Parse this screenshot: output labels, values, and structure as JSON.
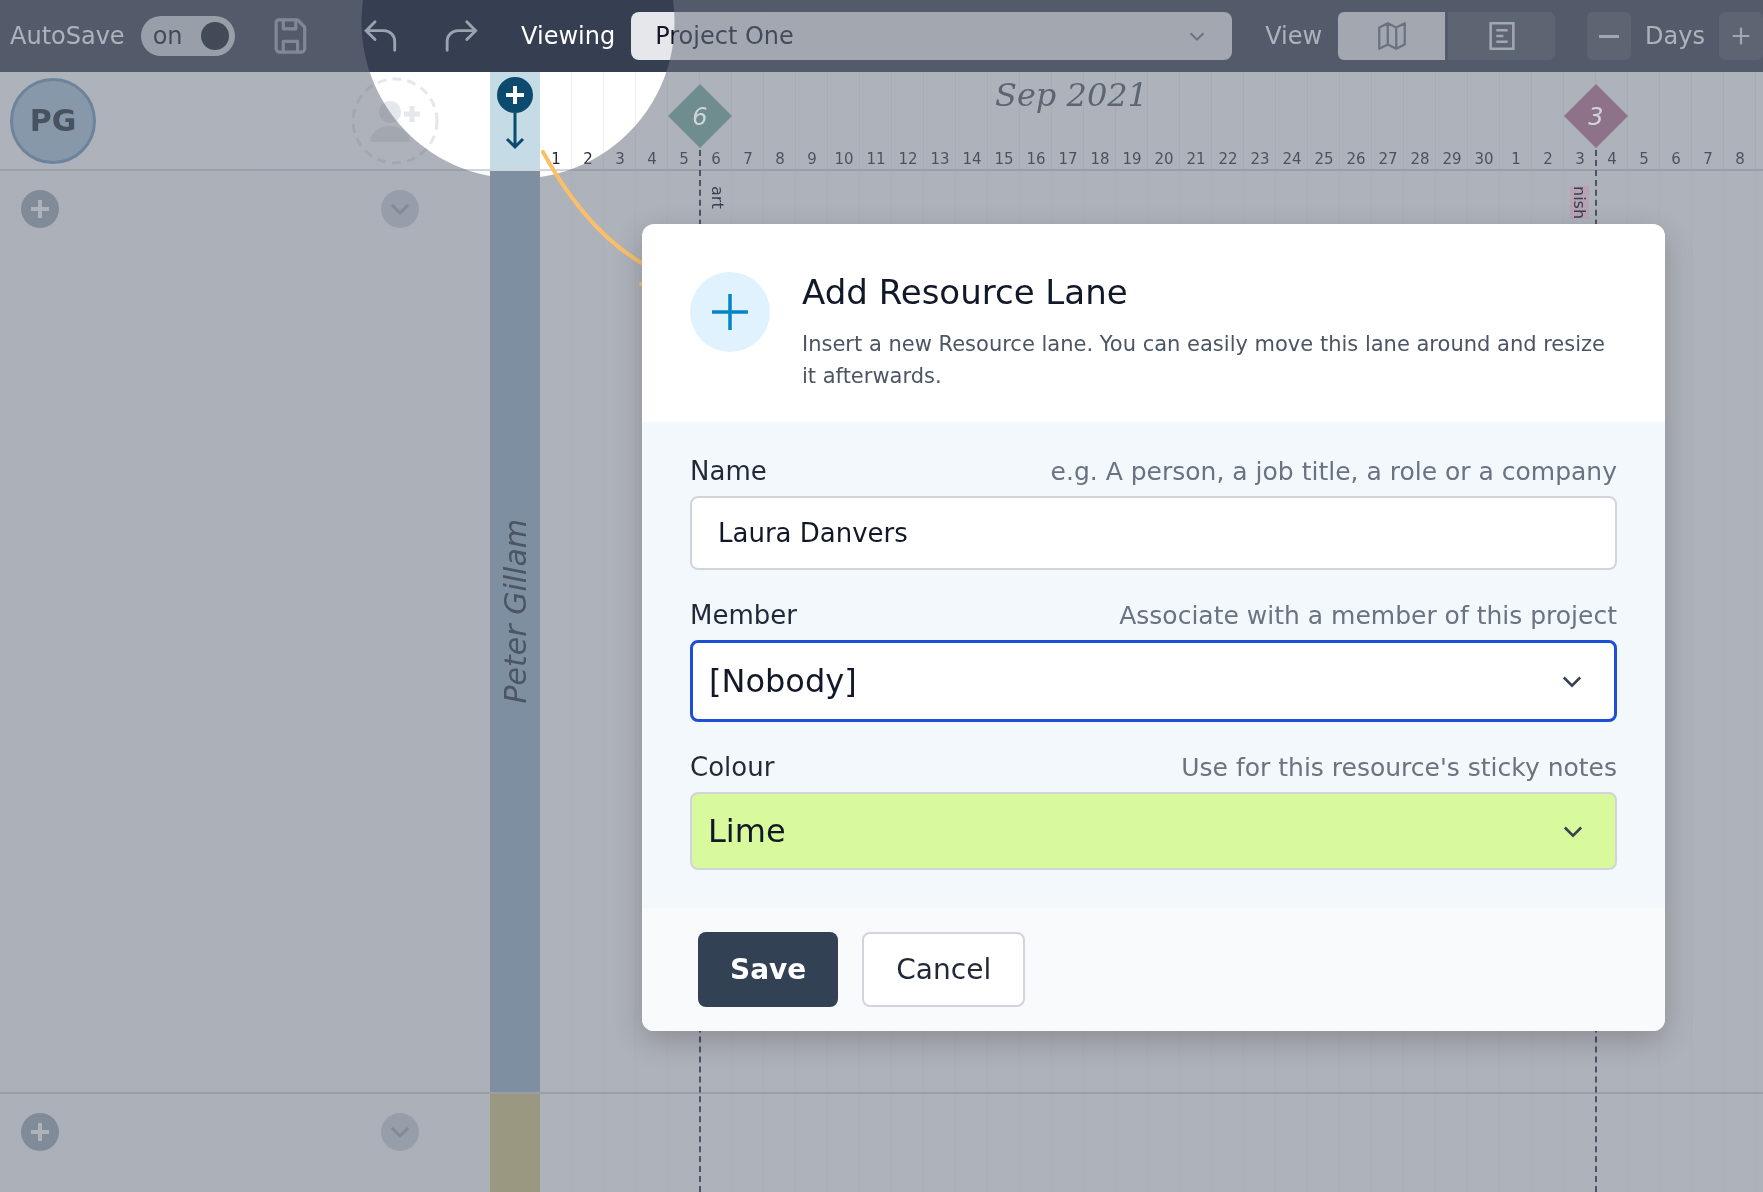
{
  "toolbar": {
    "autosave_label": "AutoSave",
    "autosave_toggle": {
      "label": "on",
      "on": true
    },
    "viewing_label": "Viewing",
    "project_select": {
      "value": "Project One"
    },
    "view_label": "View",
    "view_modes": [
      {
        "kind": "map",
        "selected": true
      },
      {
        "kind": "list",
        "selected": false
      }
    ],
    "zoom_label": "Days"
  },
  "header": {
    "avatar": "PG",
    "month": "Sep 2021",
    "days": [
      "1",
      "2",
      "3",
      "4",
      "5",
      "6",
      "7",
      "8",
      "9",
      "10",
      "11",
      "12",
      "13",
      "14",
      "15",
      "16",
      "17",
      "18",
      "19",
      "20",
      "21",
      "22",
      "23",
      "24",
      "25",
      "26",
      "27",
      "28",
      "29",
      "30",
      "1",
      "2",
      "3",
      "4",
      "5",
      "6",
      "7",
      "8"
    ]
  },
  "milestones": [
    {
      "number": "6",
      "color": "#6f8c8e",
      "label": "art"
    },
    {
      "number": "3",
      "color": "#8e7289",
      "label": "nish"
    }
  ],
  "lanes": [
    {
      "name": "Peter Gillam",
      "color": "#7f8fa2"
    },
    {
      "color": "#9a9880"
    }
  ],
  "dialog": {
    "title": "Add Resource Lane",
    "description": "Insert a new Resource lane. You can easily move this lane around and resize it afterwards.",
    "fields": [
      {
        "kind": "text",
        "label": "Name",
        "hint": "e.g. A person, a job title, a role or a company",
        "value": "Laura Danvers",
        "focused": false
      },
      {
        "kind": "select",
        "label": "Member",
        "hint": "Associate with a member of this project",
        "value": "[Nobody]",
        "focused": true
      },
      {
        "kind": "select",
        "label": "Colour",
        "hint": "Use for this resource's sticky notes",
        "value": "Lime",
        "focused": false,
        "color": "#d9f99d"
      }
    ],
    "buttons": [
      {
        "label": "Save",
        "kind": "primary"
      },
      {
        "label": "Cancel",
        "kind": "secondary"
      }
    ]
  }
}
